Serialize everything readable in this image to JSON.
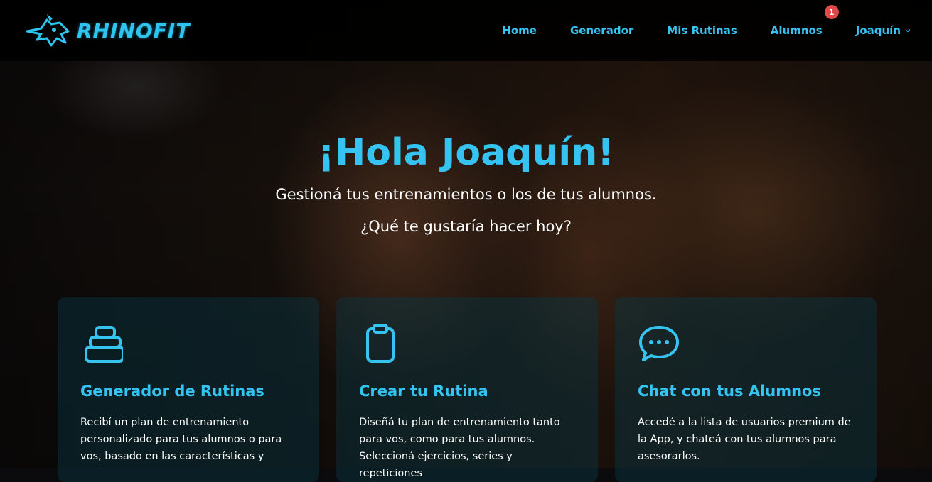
{
  "brand": {
    "name": "RHINOFIT",
    "accent_color": "#35c4f2"
  },
  "nav": {
    "items": [
      {
        "label": "Home"
      },
      {
        "label": "Generador"
      },
      {
        "label": "Mis Rutinas"
      },
      {
        "label": "Alumnos",
        "badge": "1"
      },
      {
        "label": "Joaquín",
        "icon": "chevron-down-icon"
      }
    ]
  },
  "hero": {
    "title": "¡Hola Joaquín!",
    "subtitle": "Gestioná tus entrenamientos o los de tus alumnos.",
    "question": "¿Qué te gustaría hacer hoy?"
  },
  "cards": [
    {
      "icon": "weight-icon",
      "title": "Generador de Rutinas",
      "text": "Recibí un plan de entrenamiento personalizado para tus alumnos o para vos, basado en las características y"
    },
    {
      "icon": "clipboard-icon",
      "title": "Crear tu Rutina",
      "text": "Diseñá tu plan de entrenamiento tanto para vos, como para tus alumnos. Seleccioná ejercicios, series y repeticiones"
    },
    {
      "icon": "chat-icon",
      "title": "Chat con tus Alumnos",
      "text": "Accedé a la lista de usuarios premium de la App, y chateá con tus alumnos para asesorarlos."
    }
  ]
}
